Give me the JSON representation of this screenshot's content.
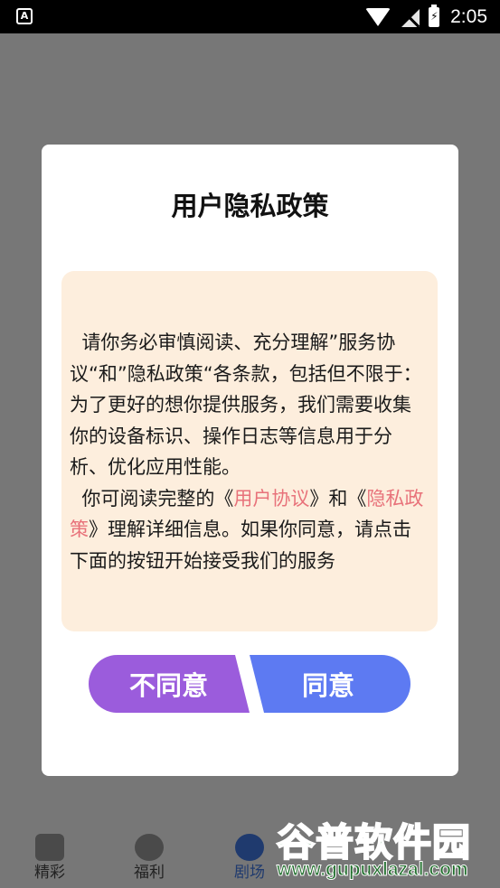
{
  "status_bar": {
    "left_icon_letter": "A",
    "time": "2:05",
    "icons": [
      "wifi-icon",
      "signal-off-icon",
      "battery-charging-icon"
    ]
  },
  "bottom_nav": {
    "items": [
      {
        "label": "精彩",
        "icon": "home-icon"
      },
      {
        "label": "福利",
        "icon": "slash-icon"
      },
      {
        "label": "剧场",
        "icon": "film-reel-icon",
        "active": true
      }
    ]
  },
  "dialog": {
    "title": "用户隐私政策",
    "para1": "  请你务必审慎阅读、充分理解”服务协议“和”隐私政策“各条款，包括但不限于：为了更好的想你提供服务，我们需要收集你的设备标识、操作日志等信息用于分析、优化应用性能。",
    "para2_prefix": "  你可阅读完整的《",
    "user_agreement_link": "用户协议",
    "para2_mid": "》和《",
    "privacy_policy_link": "隐私政策",
    "para2_suffix": "》理解详细信息。如果你同意，请点击下面的按钮开始接受我们的服务",
    "disagree_label": "不同意",
    "agree_label": "同意"
  },
  "watermark": {
    "title": "谷普软件园",
    "url": "www.gupuxlazal.com"
  },
  "colors": {
    "overlay": "#777777",
    "policy_box": "#fdeedd",
    "link": "#e8727a",
    "disagree": "#9b5cdc",
    "agree": "#5d7af2"
  }
}
